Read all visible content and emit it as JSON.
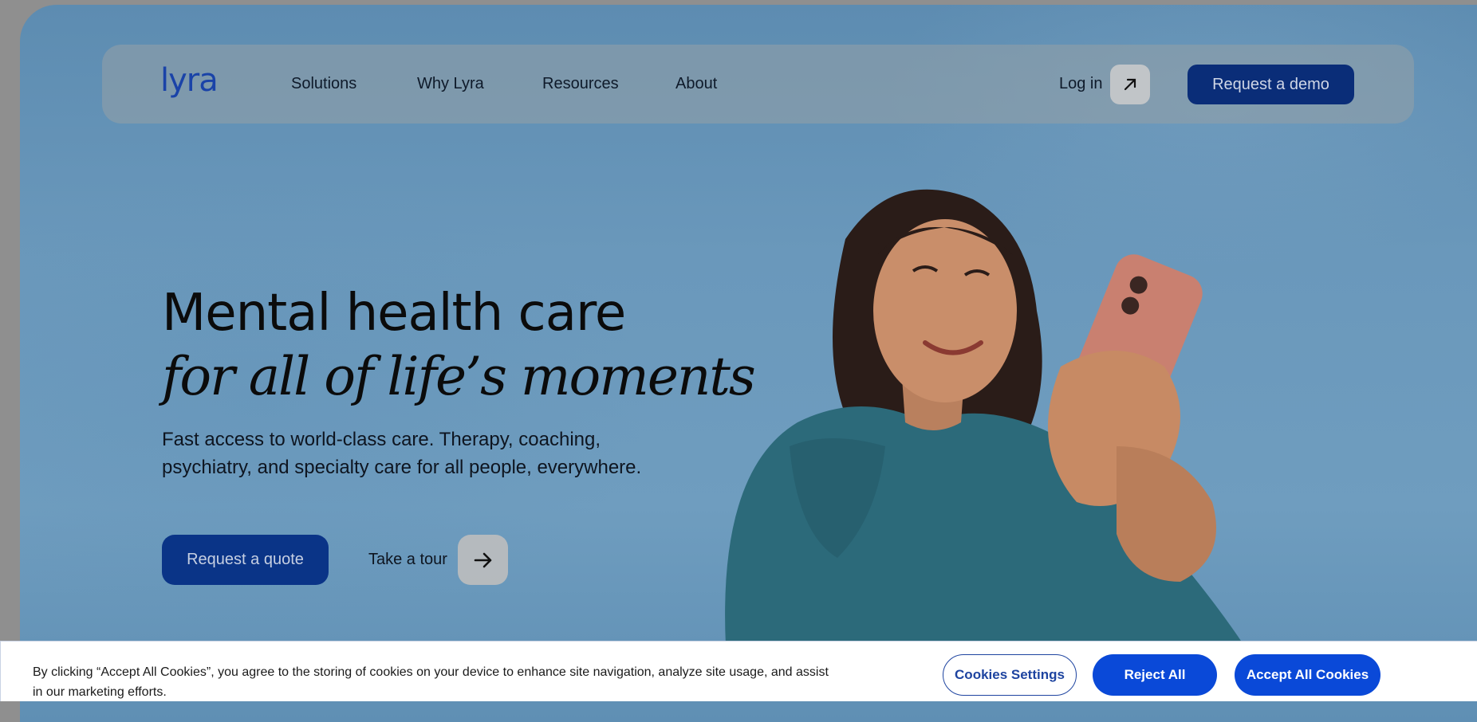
{
  "brand": {
    "logo": "lyra"
  },
  "nav": {
    "items": [
      {
        "label": "Solutions"
      },
      {
        "label": "Why Lyra"
      },
      {
        "label": "Resources"
      },
      {
        "label": "About"
      }
    ],
    "login_label": "Log in",
    "demo_label": "Request a demo"
  },
  "hero": {
    "headline": "Mental health care",
    "headline_italic": "for all of life’s moments",
    "subtitle": "Fast access to world-class care. Therapy, coaching, psychiatry, and specialty care for all people, everywhere.",
    "quote_label": "Request a quote",
    "tour_label": "Take a tour"
  },
  "cookie_banner": {
    "text": "By clicking “Accept All Cookies”, you agree to the storing of cookies on your device to enhance site navigation, analyze site usage, and assist in our marketing efforts.",
    "settings_label": "Cookies Settings",
    "reject_label": "Reject All",
    "accept_label": "Accept All Cookies"
  },
  "colors": {
    "brand_blue": "#0a2d78",
    "cta_blue": "#0a49d8",
    "sky": "#6a98bb"
  },
  "icons": {
    "login": "arrow-up-right-icon",
    "tour": "arrow-right-icon"
  }
}
